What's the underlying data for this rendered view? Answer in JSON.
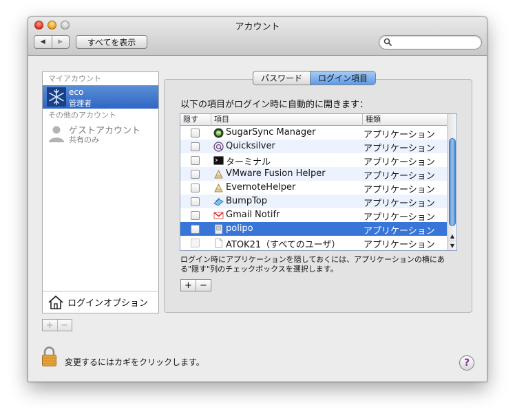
{
  "window": {
    "title": "アカウント"
  },
  "toolbar": {
    "back_glyph": "◀",
    "forward_glyph": "▶",
    "show_all_label": "すべてを表示",
    "search_placeholder": ""
  },
  "accounts": {
    "my_account_header": "マイアカウント",
    "current_user": {
      "name": "eco",
      "role": "管理者"
    },
    "other_accounts_header": "その他のアカウント",
    "guest": {
      "name": "ゲストアカウント",
      "role": "共有のみ"
    },
    "login_options_label": "ログインオプション",
    "add_label": "+",
    "remove_label": "−"
  },
  "tabs": {
    "password": "パスワード",
    "login_items": "ログイン項目",
    "active": "login_items"
  },
  "login_items": {
    "instruction": "以下の項目がログイン時に自動的に開きます：",
    "columns": {
      "hide": "隠す",
      "item": "項目",
      "kind": "種類"
    },
    "rows": [
      {
        "name": "SugarSync Manager",
        "kind": "アプリケーション",
        "icon": "sugarsync-icon",
        "selected": false
      },
      {
        "name": "Quicksilver",
        "kind": "アプリケーション",
        "icon": "quicksilver-icon",
        "selected": false
      },
      {
        "name": "ターミナル",
        "kind": "アプリケーション",
        "icon": "terminal-icon",
        "selected": false
      },
      {
        "name": "VMware Fusion Helper",
        "kind": "アプリケーション",
        "icon": "app-generic-icon",
        "selected": false
      },
      {
        "name": "EvernoteHelper",
        "kind": "アプリケーション",
        "icon": "app-generic-icon",
        "selected": false
      },
      {
        "name": "BumpTop",
        "kind": "アプリケーション",
        "icon": "bumptop-icon",
        "selected": false
      },
      {
        "name": "Gmail Notifr",
        "kind": "アプリケーション",
        "icon": "gmail-icon",
        "selected": false
      },
      {
        "name": "polipo",
        "kind": "アプリケーション",
        "icon": "document-icon",
        "selected": true
      },
      {
        "name": "ATOK21（すべてのユーザ）",
        "kind": "アプリケーション",
        "icon": "document-icon",
        "selected": false
      }
    ],
    "hint": "ログイン時にアプリケーションを隠しておくには、アプリケーションの横にある\"隠す\"列のチェックボックスを選択します。",
    "add_label": "+",
    "remove_label": "−"
  },
  "footer": {
    "lock_text": "変更するにはカギをクリックします。",
    "help_label": "?"
  },
  "colors": {
    "selection": "#3875d7",
    "tab_active": "#5d9be7",
    "row_alt": "#edf3fe"
  }
}
